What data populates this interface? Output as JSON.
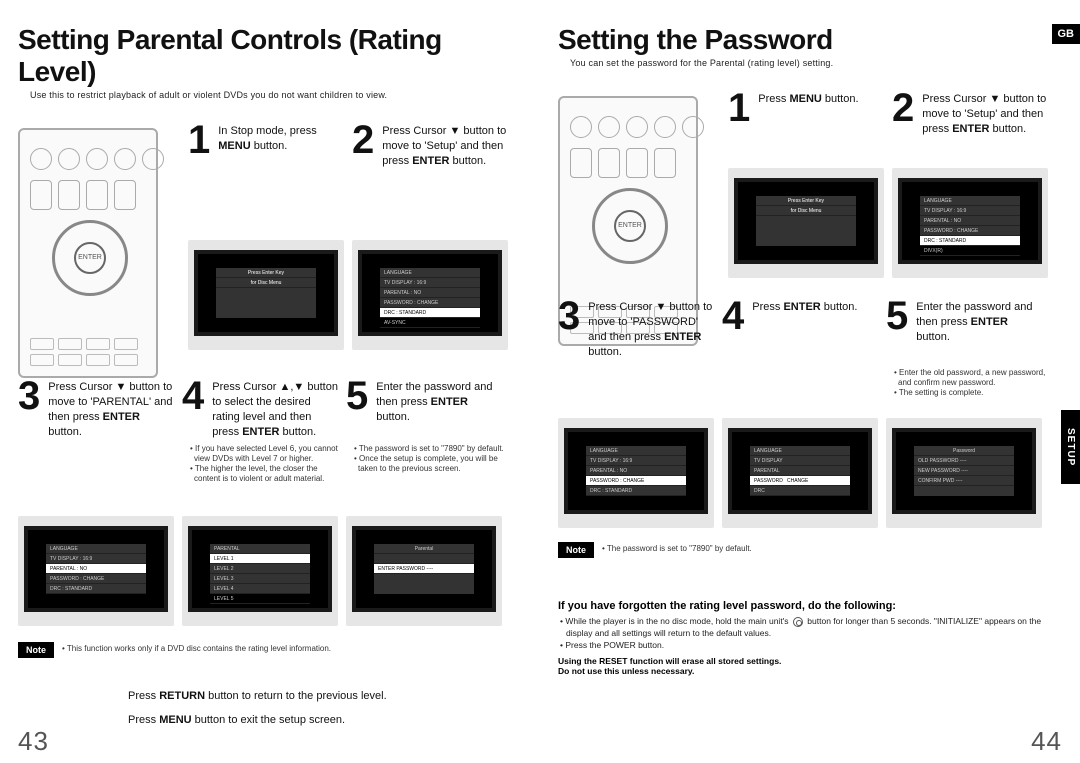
{
  "region": "GB",
  "sideTab": "SETUP",
  "left": {
    "heading": "Setting Parental Controls (Rating Level)",
    "sub": "Use this to restrict playback of adult or violent DVDs you do not want children to view.",
    "steps": {
      "s1": {
        "num": "1",
        "text": "In Stop mode, press <b>MENU</b> button."
      },
      "s2": {
        "num": "2",
        "text": "Press Cursor ▼ button to move to 'Setup' and then press <b>ENTER</b> button."
      },
      "s3": {
        "num": "3",
        "text": "Press Cursor ▼ button to move to 'PARENTAL' and then press <b>ENTER</b> button."
      },
      "s4": {
        "num": "4",
        "text": "Press Cursor ▲,▼ button to select the desired rating level and then press <b>ENTER</b> button."
      },
      "s5": {
        "num": "5",
        "text": "Enter the password and then press <b>ENTER</b> button."
      }
    },
    "step4notes": [
      "If you have selected Level 6, you cannot view DVDs with Level 7 or higher.",
      "The higher the level, the closer the content is to violent or adult material."
    ],
    "step5notes": [
      "The password is set to \"7890\" by default.",
      "Once the setup is complete, you will be taken to the previous screen."
    ],
    "noteLabel": "Note",
    "footnote": "This function works only if a DVD disc contains the rating level information.",
    "return": "Press <b>RETURN</b> button to return to the previous level.",
    "menuexit": "Press <b>MENU</b> button to exit the setup screen.",
    "pagenum": "43"
  },
  "right": {
    "heading": "Setting the Password",
    "sub": "You can set the password for the Parental (rating level) setting.",
    "steps": {
      "s1": {
        "num": "1",
        "text": "Press <b>MENU</b> button."
      },
      "s2": {
        "num": "2",
        "text": "Press Cursor ▼ button to move to 'Setup' and then press <b>ENTER</b> button."
      },
      "s3": {
        "num": "3",
        "text": "Press Cursor ▼ button to move to 'PASSWORD' and then press <b>ENTER</b> button."
      },
      "s4": {
        "num": "4",
        "text": "Press <b>ENTER</b> button."
      },
      "s5": {
        "num": "5",
        "text": "Enter the password and then press <b>ENTER</b> button."
      }
    },
    "step5notes": [
      "Enter the old password, a new password, and confirm new password.",
      "The setting is complete."
    ],
    "noteLabel": "Note",
    "footnote": "The password is set to \"7890\" by default.",
    "forgotTitle": "If you have forgotten the rating level password, do the following:",
    "forgotBullets": [
      "While the player is in the no disc mode, hold the main unit's  button for longer than 5 seconds. \"INITIALIZE\" appears on the display and all settings will return to the default values.",
      "Press the POWER button."
    ],
    "bold1": "Using the RESET function will erase all stored settings.",
    "bold2": "Do not use this unless necessary.",
    "pagenum": "44"
  }
}
